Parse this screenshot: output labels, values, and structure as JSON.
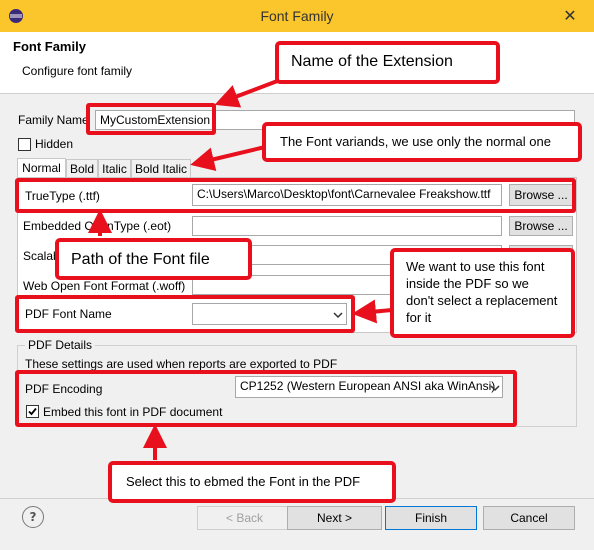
{
  "window": {
    "title": "Font Family",
    "close_glyph": "✕",
    "app_icon": "eclipse-icon",
    "close_icon": "close-icon"
  },
  "header": {
    "title": "Font Family",
    "subtitle": "Configure font family"
  },
  "form": {
    "family_name_label": "Family Name",
    "family_name_value": "MyCustomExtension",
    "hidden_label": "Hidden",
    "tabs": [
      "Normal",
      "Bold",
      "Italic",
      "Bold Italic"
    ],
    "truetype_label": "TrueType (.ttf)",
    "truetype_value": "C:\\Users\\Marco\\Desktop\\font\\Carnevalee Freakshow.ttf",
    "browse_label": "Browse ...",
    "eot_label": "Embedded OpenType (.eot)",
    "svg_label": "Scalable Vector Graphics (.svg)",
    "woff_label": "Web Open Font Format (.woff)",
    "pdf_font_name_label": "PDF Font Name",
    "pdf_details_legend": "PDF Details",
    "pdf_details_note": "These settings are used when reports are exported to PDF",
    "pdf_encoding_label": "PDF Encoding",
    "pdf_encoding_value": "CP1252 (Western European ANSI aka WinAnsi)",
    "embed_label": "Embed this font in PDF document",
    "embed_checked": true
  },
  "footer": {
    "help_glyph": "?",
    "back_label": "< Back",
    "next_label": "Next >",
    "finish_label": "Finish",
    "cancel_label": "Cancel"
  },
  "annotations": {
    "name_extension": "Name of the Extension",
    "font_variants": "The Font variands, we use only the normal one",
    "font_path": "Path of the Font file",
    "pdf_inside": "We want to use this font inside the PDF so we don't select a replacement for it",
    "embed_pdf": "Select this to ebmed the Font in the PDF"
  },
  "colors": {
    "title_bar": "#fbc52c",
    "annotation_red": "#e8101c"
  }
}
